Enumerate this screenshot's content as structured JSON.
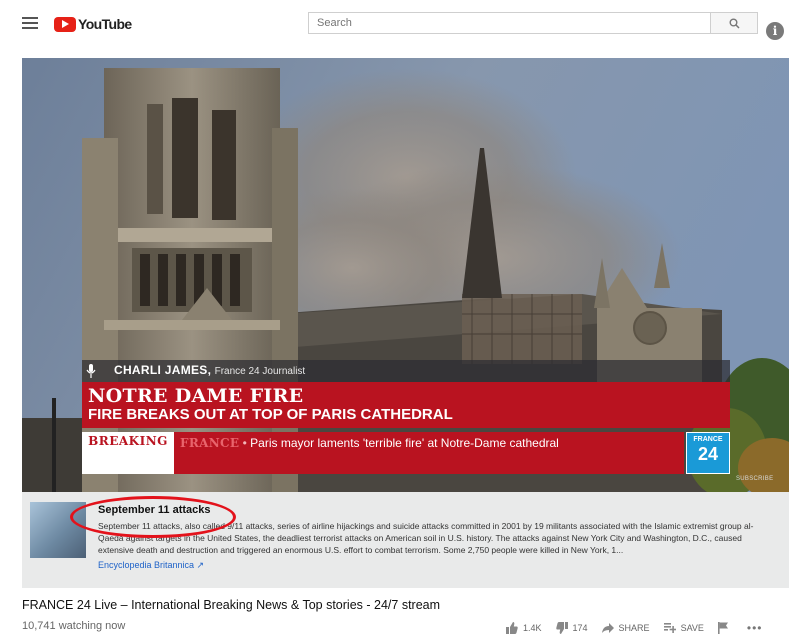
{
  "header": {
    "logo_text": "YouTube",
    "search_placeholder": "Search"
  },
  "overlay": {
    "reporter_name": "CHARLI JAMES,",
    "reporter_role": "France 24 Journalist",
    "headline": "NOTRE DAME FIRE",
    "subheadline": "FIRE BREAKS OUT AT TOP OF PARIS CATHEDRAL",
    "breaking_label": "BREAKING",
    "ticker_source": "FRANCE",
    "ticker_separator": " • ",
    "ticker_text": "Paris mayor laments 'terrible fire' at Notre-Dame cathedral",
    "channel_logo_top": "FRANCE",
    "channel_logo_num": "24",
    "subscribe_label": "SUBSCRIBE"
  },
  "knowledge_panel": {
    "title": "September 11 attacks",
    "body": "September 11 attacks, also called 9/11 attacks, series of airline hijackings and suicide attacks committed in 2001 by 19 militants associated with the Islamic extremist group al-Qaeda against targets in the United States, the deadliest terrorist attacks on American soil in U.S. history. The attacks against New York City and Washington, D.C., caused extensive death and destruction and triggered an enormous U.S. effort to combat terrorism. Some 2,750 people were killed in New York, 1...",
    "source": "Encyclopedia Britannica ↗"
  },
  "video": {
    "title": "FRANCE 24 Live – International Breaking News & Top stories - 24/7 stream",
    "views": "10,741 watching now",
    "likes": "1.4K",
    "dislikes": "174",
    "share_label": "SHARE",
    "save_label": "SAVE",
    "more_label": "•••"
  },
  "icons": {
    "menu": "menu-icon",
    "search": "search-icon",
    "info": "info-icon",
    "like": "thumbs-up-icon",
    "dislike": "thumbs-down-icon",
    "share": "share-icon",
    "save": "playlist-add-icon",
    "flag": "flag-icon"
  },
  "colors": {
    "brand_red": "#e62117",
    "news_red": "#b91320",
    "france24_blue": "#1a9ad7",
    "annotation_red": "#e3121b",
    "link_blue": "#1e62c8"
  }
}
